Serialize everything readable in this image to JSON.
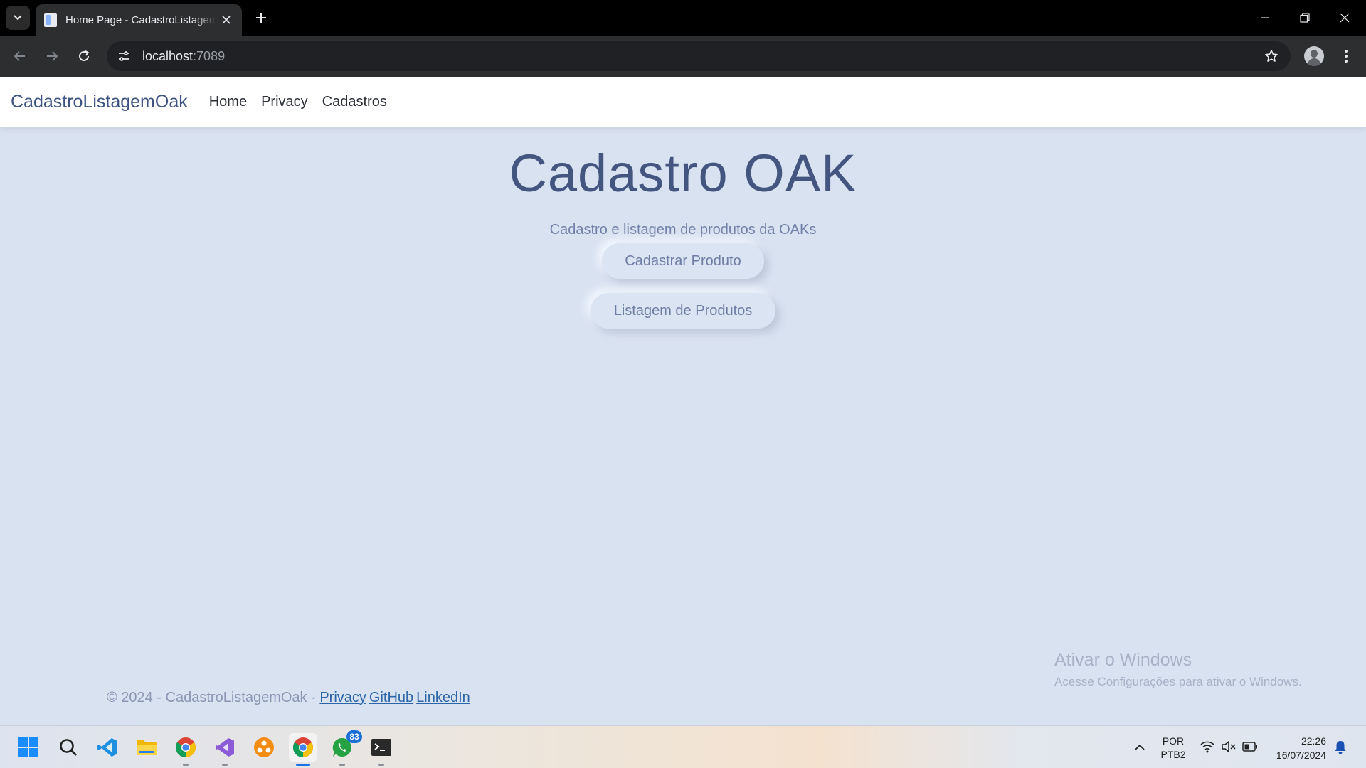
{
  "browser": {
    "tab_title": "Home Page - CadastroListagemOak",
    "url_host": "localhost",
    "url_port": ":7089"
  },
  "navbar": {
    "brand": "CadastroListagemOak",
    "links": [
      "Home",
      "Privacy",
      "Cadastros"
    ]
  },
  "hero": {
    "title": "Cadastro OAK",
    "subtitle": "Cadastro e listagem de produtos da OAKs",
    "buttons": [
      "Cadastrar Produto",
      "Listagem de Produtos"
    ]
  },
  "footer": {
    "copyright": "© 2024 - CadastroListagemOak - ",
    "links": [
      "Privacy",
      "GitHub",
      "LinkedIn"
    ]
  },
  "watermark": {
    "title": "Ativar o Windows",
    "subtitle": "Acesse Configurações para ativar o Windows."
  },
  "taskbar": {
    "icons": [
      "windows-start-icon",
      "search-icon",
      "vscode-icon",
      "file-explorer-icon",
      "chrome-icon",
      "visual-studio-icon",
      "app-icon",
      "chrome-active-icon",
      "whatsapp-icon",
      "terminal-icon"
    ],
    "whatsapp_badge": "83",
    "language_line1": "POR",
    "language_line2": "PTB2",
    "time": "22:26",
    "date": "16/07/2024"
  },
  "colors": {
    "page_background": "#d9e2f1",
    "brand": "#3d5483",
    "title": "#44557f",
    "link": "#2c66a8"
  }
}
